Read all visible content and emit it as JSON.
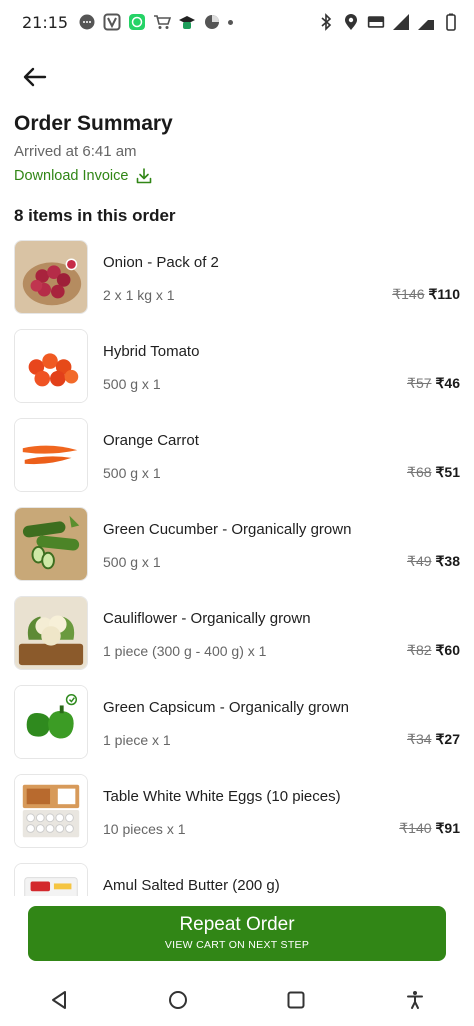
{
  "status_bar": {
    "time": "21:15",
    "left_icons": [
      "chat-bubble-icon",
      "v-app-icon",
      "whatsapp-icon",
      "cart-icon",
      "graduation-cap-icon",
      "pie-icon",
      "more-dot-icon"
    ],
    "right_icons": [
      "bluetooth-icon",
      "location-icon",
      "volte-icon",
      "signal-icon",
      "4g-signal-icon",
      "battery-icon"
    ]
  },
  "header": {
    "title": "Order Summary",
    "arrival_text": "Arrived at 6:41 am",
    "invoice_label": "Download Invoice",
    "items_count_label": "8 items in this order"
  },
  "items": [
    {
      "name": "Onion - Pack of 2",
      "qty": "2 x 1 kg x 1",
      "mrp": "₹146",
      "price": "₹110"
    },
    {
      "name": "Hybrid Tomato",
      "qty": "500 g x 1",
      "mrp": "₹57",
      "price": "₹46"
    },
    {
      "name": "Orange Carrot",
      "qty": "500 g x 1",
      "mrp": "₹68",
      "price": "₹51"
    },
    {
      "name": "Green Cucumber - Organically grown",
      "qty": "500 g x 1",
      "mrp": "₹49",
      "price": "₹38"
    },
    {
      "name": "Cauliflower - Organically grown",
      "qty": "1 piece (300 g - 400 g) x 1",
      "mrp": "₹82",
      "price": "₹60"
    },
    {
      "name": "Green Capsicum - Organically grown",
      "qty": "1 piece x 1",
      "mrp": "₹34",
      "price": "₹27"
    },
    {
      "name": "Table White White Eggs (10 pieces)",
      "qty": "10 pieces x 1",
      "mrp": "₹140",
      "price": "₹91"
    },
    {
      "name": "Amul Salted Butter (200 g)",
      "qty": "",
      "mrp": "",
      "price": ""
    }
  ],
  "cta": {
    "label": "Repeat Order",
    "sub_label": "VIEW CART ON NEXT STEP",
    "color": "#318616"
  },
  "nav_bar": {
    "icons": [
      "back-triangle-icon",
      "home-circle-icon",
      "recents-square-icon",
      "accessibility-icon"
    ]
  }
}
